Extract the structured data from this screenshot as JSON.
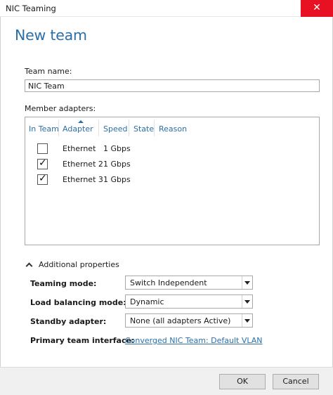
{
  "window": {
    "title": "NIC Teaming",
    "close_glyph": "✕"
  },
  "heading": "New team",
  "team_name": {
    "label": "Team name:",
    "value": "NIC Team"
  },
  "member_adapters": {
    "label": "Member adapters:",
    "columns": [
      "In Team",
      "Adapter",
      "Speed",
      "State",
      "Reason"
    ],
    "rows": [
      {
        "in_team": false,
        "adapter": "Ethernet",
        "speed": "1 Gbps",
        "state": "",
        "reason": ""
      },
      {
        "in_team": true,
        "adapter": "Ethernet 2",
        "speed": "1 Gbps",
        "state": "",
        "reason": ""
      },
      {
        "in_team": true,
        "adapter": "Ethernet 3",
        "speed": "1 Gbps",
        "state": "",
        "reason": ""
      }
    ]
  },
  "additional_properties": {
    "label": "Additional properties",
    "teaming_mode": {
      "label": "Teaming mode:",
      "value": "Switch Independent"
    },
    "load_balancing_mode": {
      "label": "Load balancing mode:",
      "value": "Dynamic"
    },
    "standby_adapter": {
      "label": "Standby adapter:",
      "value": "None (all adapters Active)"
    },
    "primary_team_interface": {
      "label": "Primary team interface:",
      "link": "Converged NIC Team: Default VLAN"
    }
  },
  "buttons": {
    "ok": "OK",
    "cancel": "Cancel"
  },
  "icons": {
    "checkbox_checked": "checkmark-icon",
    "expander": "chevron-up-icon",
    "dropdown": "chevron-down-icon",
    "close": "close-icon"
  },
  "colors": {
    "accent": "#2a6fa8",
    "close_button": "#e81123"
  }
}
